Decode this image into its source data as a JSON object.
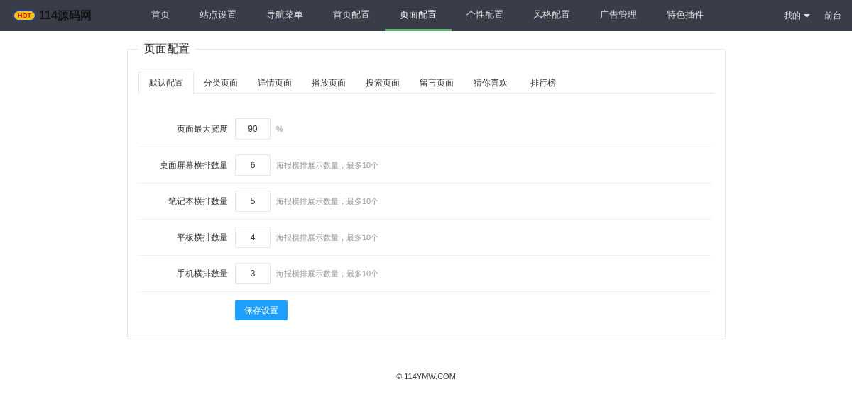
{
  "header": {
    "logo": {
      "badge": "HOT",
      "text": "114源码网"
    },
    "nav": [
      {
        "label": "首页",
        "selected": false
      },
      {
        "label": "站点设置",
        "selected": false
      },
      {
        "label": "导航菜单",
        "selected": false
      },
      {
        "label": "首页配置",
        "selected": false
      },
      {
        "label": "页面配置",
        "selected": true
      },
      {
        "label": "个性配置",
        "selected": false
      },
      {
        "label": "风格配置",
        "selected": false
      },
      {
        "label": "广告管理",
        "selected": false
      },
      {
        "label": "特色插件",
        "selected": false
      }
    ],
    "right": [
      {
        "label": "我的",
        "kind": "dropdown"
      },
      {
        "label": "前台",
        "kind": "link"
      }
    ]
  },
  "panel": {
    "title": "页面配置",
    "tabs": [
      {
        "label": "默认配置",
        "selected": true
      },
      {
        "label": "分类页面",
        "selected": false
      },
      {
        "label": "详情页面",
        "selected": false
      },
      {
        "label": "播放页面",
        "selected": false
      },
      {
        "label": "搜索页面",
        "selected": false
      },
      {
        "label": "留言页面",
        "selected": false
      },
      {
        "label": "猜你喜欢",
        "selected": false
      },
      {
        "label": "排行榜",
        "selected": false
      }
    ],
    "fields": [
      {
        "label": "页面最大宽度",
        "value": "90",
        "hint": "%"
      },
      {
        "label": "桌面屏幕横排数量",
        "value": "6",
        "hint": "海报横排展示数量，最多10个"
      },
      {
        "label": "笔记本横排数量",
        "value": "5",
        "hint": "海报横排展示数量，最多10个"
      },
      {
        "label": "平板横排数量",
        "value": "4",
        "hint": "海报横排展示数量，最多10个"
      },
      {
        "label": "手机横排数量",
        "value": "3",
        "hint": "海报横排展示数量，最多10个"
      }
    ],
    "button": "保存设置"
  },
  "footer": "© 114YMW.COM"
}
